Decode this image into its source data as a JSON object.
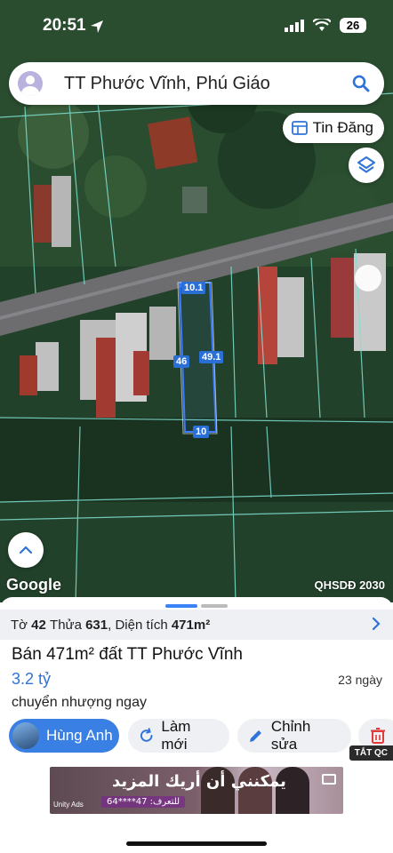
{
  "status": {
    "time": "20:51",
    "battery": "26"
  },
  "search": {
    "location": "TT Phước Vĩnh, Phú Giáo"
  },
  "map_controls": {
    "tin_dang_label": "Tin Đăng"
  },
  "map": {
    "attribution": "Google",
    "plan_layer": "QHSDĐ 2030",
    "dimensions": {
      "top": "10.1",
      "left": "46",
      "right": "49.1",
      "bottom": "10"
    }
  },
  "parcel": {
    "to_label": "Tờ",
    "to": "42",
    "thua_label": "Thửa",
    "thua": "631",
    "area_label": "Diện tích",
    "area": "471m²"
  },
  "listing": {
    "title": "Bán 471m² đất TT Phước Vĩnh",
    "price": "3.2 tỷ",
    "age": "23 ngày",
    "description": "chuyển nhượng ngay"
  },
  "actions": {
    "owner_name": "Hùng Anh",
    "refresh_label": "Làm mới",
    "edit_label": "Chỉnh sửa"
  },
  "ad": {
    "close_label": "TẮT QC",
    "headline": "يمكنني أن أريك المزيد",
    "code": "64****47 :للتعرف",
    "sponsor": "Unity Ads"
  },
  "colors": {
    "accent": "#3a7fe3",
    "price": "#2f73d9",
    "dimension_label": "#2a6fd6"
  }
}
